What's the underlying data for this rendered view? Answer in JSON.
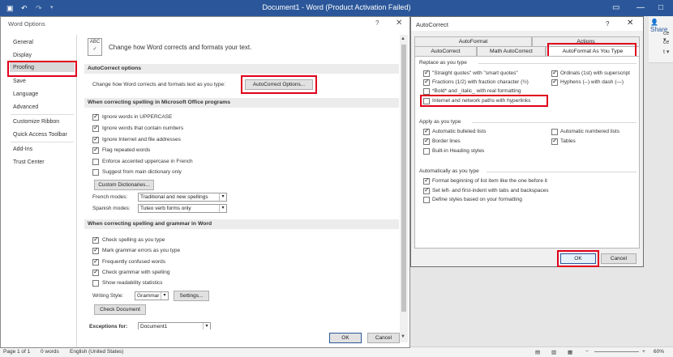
{
  "word": {
    "title": "Document1 - Word (Product Activation Failed)",
    "share_label": "Share",
    "statusbar": {
      "page": "Page 1 of 1",
      "words": "0 words",
      "language": "English (United States)",
      "zoom": "60%"
    }
  },
  "word_options": {
    "title": "Word Options",
    "help": "?",
    "close": "✕",
    "nav": [
      "General",
      "Display",
      "Proofing",
      "Save",
      "Language",
      "Advanced",
      "Customize Ribbon",
      "Quick Access Toolbar",
      "Add-Ins",
      "Trust Center"
    ],
    "selected_nav": "Proofing",
    "intro": "Change how Word corrects and formats your text.",
    "autocorrect_section": {
      "heading": "AutoCorrect options",
      "label": "Change how Word corrects and formats text as you type:",
      "button": "AutoCorrect Options..."
    },
    "spelling_ms": {
      "heading": "When correcting spelling in Microsoft Office programs",
      "options": [
        {
          "label": "Ignore words in UPPERCASE",
          "checked": true
        },
        {
          "label": "Ignore words that contain numbers",
          "checked": true
        },
        {
          "label": "Ignore Internet and file addresses",
          "checked": true
        },
        {
          "label": "Flag repeated words",
          "checked": true
        },
        {
          "label": "Enforce accented uppercase in French",
          "checked": false
        },
        {
          "label": "Suggest from main dictionary only",
          "checked": false
        }
      ],
      "custom_dict_button": "Custom Dictionaries...",
      "french_label": "French modes:",
      "french_value": "Traditional and new spellings",
      "spanish_label": "Spanish modes:",
      "spanish_value": "Tuteo verb forms only"
    },
    "grammar_word": {
      "heading": "When correcting spelling and grammar in Word",
      "options": [
        {
          "label": "Check spelling as you type",
          "checked": true
        },
        {
          "label": "Mark grammar errors as you type",
          "checked": true
        },
        {
          "label": "Frequently confused words",
          "checked": true
        },
        {
          "label": "Check grammar with spelling",
          "checked": true
        },
        {
          "label": "Show readability statistics",
          "checked": false
        }
      ],
      "writing_style_label": "Writing Style:",
      "writing_style_value": "Grammar",
      "settings_button": "Settings...",
      "check_doc_button": "Check Document"
    },
    "exceptions_label": "Exceptions for:",
    "exceptions_value": "Document1",
    "ok": "OK",
    "cancel": "Cancel"
  },
  "autocorrect": {
    "title": "AutoCorrect",
    "help": "?",
    "close": "✕",
    "tabs_row1": [
      "AutoFormat",
      "Actions"
    ],
    "tabs_row2": [
      "AutoCorrect",
      "Math AutoCorrect",
      "AutoFormat As You Type"
    ],
    "active_tab": "AutoFormat As You Type",
    "replace_group": "Replace as you type",
    "replace_left": [
      {
        "label": "\"Straight quotes\" with \"smart quotes\"",
        "checked": true
      },
      {
        "label": "Fractions (1/2) with fraction character (½)",
        "checked": true
      },
      {
        "label": "*Bold* and _italic_ with real formatting",
        "checked": false
      },
      {
        "label": "Internet and network paths with hyperlinks",
        "checked": false
      }
    ],
    "replace_right": [
      {
        "label": "Ordinals (1st) with superscript",
        "checked": true
      },
      {
        "label": "Hyphens (--) with dash (—)",
        "checked": true
      }
    ],
    "apply_group": "Apply as you type",
    "apply_left": [
      {
        "label": "Automatic bulleted lists",
        "checked": true
      },
      {
        "label": "Border lines",
        "checked": true
      },
      {
        "label": "Built-in Heading styles",
        "checked": false
      }
    ],
    "apply_right": [
      {
        "label": "Automatic numbered lists",
        "checked": false
      },
      {
        "label": "Tables",
        "checked": true
      }
    ],
    "auto_group": "Automatically as you type",
    "auto_options": [
      {
        "label": "Format beginning of list item like the one before it",
        "checked": true
      },
      {
        "label": "Set left- and first-indent with tabs and backspaces",
        "checked": true
      },
      {
        "label": "Define styles based on your formatting",
        "checked": false
      }
    ],
    "ok": "OK",
    "cancel": "Cancel"
  },
  "colors": {
    "word_blue": "#2b579a",
    "highlight_red": "#e0001b"
  }
}
